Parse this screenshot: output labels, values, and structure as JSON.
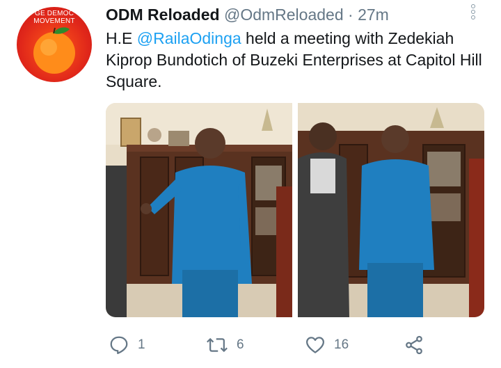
{
  "tweet": {
    "display_name": "ODM Reloaded",
    "handle": "@OdmReloaded",
    "separator": "·",
    "time": "27m",
    "text_prefix": "H.E ",
    "mention": "@RailaOdinga",
    "text_suffix": " held a meeting with Zedekiah Kiprop Bundotich of Buzeki Enterprises at Capitol Hill Square."
  },
  "avatar": {
    "ring_text_line1": "GE DEMOC",
    "ring_text_line2": "MOVEMENT"
  },
  "actions": {
    "reply_count": "1",
    "retweet_count": "6",
    "like_count": "16"
  },
  "icons": {
    "reply": "reply-icon",
    "retweet": "retweet-icon",
    "like": "heart-icon",
    "share": "share-icon",
    "more": "more-options-icon"
  },
  "colors": {
    "mention": "#1da1f2",
    "secondary_text": "#657786",
    "shirt_blue": "#1f7fc0",
    "avatar_red": "#e0271a"
  }
}
